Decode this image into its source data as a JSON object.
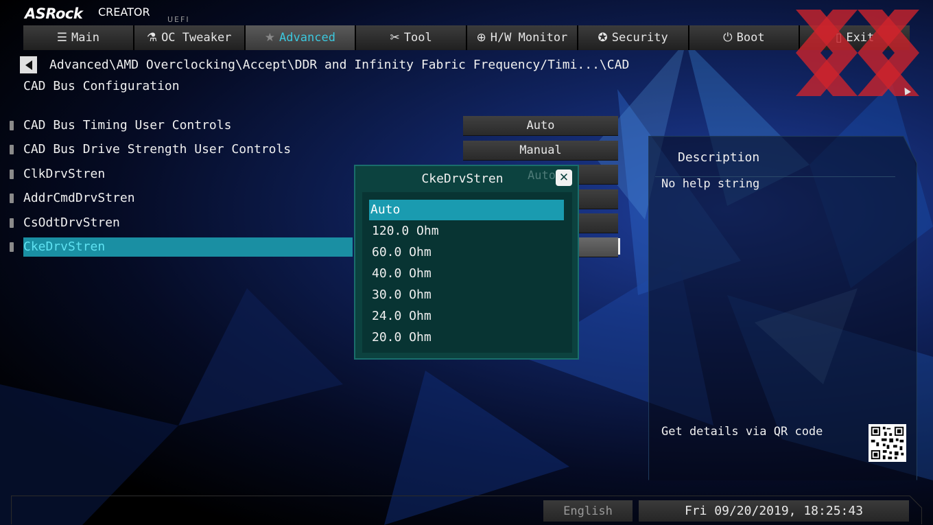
{
  "brand": {
    "name": "ASRock",
    "edition": "CREATOR",
    "firmware": "UEFI"
  },
  "nav": {
    "tabs": [
      {
        "label": "Main",
        "icon": "list-icon"
      },
      {
        "label": "OC Tweaker",
        "icon": "rocket-icon"
      },
      {
        "label": "Advanced",
        "icon": "star-icon"
      },
      {
        "label": "Tool",
        "icon": "tools-icon"
      },
      {
        "label": "H/W Monitor",
        "icon": "crosshair-icon"
      },
      {
        "label": "Security",
        "icon": "shield-icon"
      },
      {
        "label": "Boot",
        "icon": "power-icon"
      },
      {
        "label": "Exit",
        "icon": "exit-door-icon"
      }
    ],
    "active": "Advanced"
  },
  "breadcrumb": "Advanced\\AMD Overclocking\\Accept\\DDR and Infinity Fabric Frequency/Timi...\\CAD",
  "page_title": "CAD Bus Configuration",
  "settings": [
    {
      "label": "CAD Bus Timing User Controls",
      "value": "Auto"
    },
    {
      "label": "CAD Bus Drive Strength User Controls",
      "value": "Manual"
    },
    {
      "label": "ClkDrvStren",
      "value": "Auto"
    },
    {
      "label": "AddrCmdDrvStren",
      "value": ""
    },
    {
      "label": "CsOdtDrvStren",
      "value": ""
    },
    {
      "label": "CkeDrvStren",
      "value": ""
    }
  ],
  "selected_setting": "CkeDrvStren",
  "description": {
    "title": "Description",
    "text": "No help string",
    "qr_label": "Get details via QR code"
  },
  "dialog": {
    "title": "CkeDrvStren",
    "close_label": "✕",
    "options": [
      "Auto",
      "120.0 Ohm",
      "60.0 Ohm",
      "40.0 Ohm",
      "30.0 Ohm",
      "24.0 Ohm",
      "20.0 Ohm"
    ],
    "selected": "Auto"
  },
  "footer": {
    "language": "English",
    "datetime": "Fri 09/20/2019, 18:25:43"
  },
  "colors": {
    "accent": "#3cc8de",
    "selection": "#1a8fa3",
    "dialog_bg": "#0c423f",
    "watermark": "#d0242c"
  }
}
